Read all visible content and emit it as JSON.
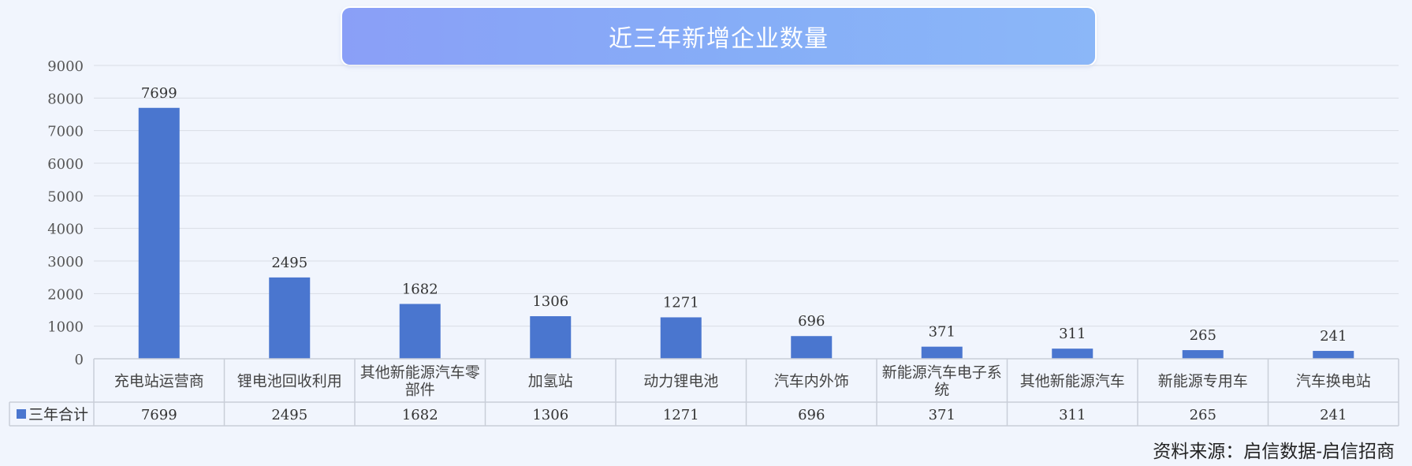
{
  "title": "近三年新增企业数量",
  "source": "资料来源：启信数据-启信招商",
  "colors": {
    "bar": "#4a76cf",
    "grid": "#d9dde5",
    "table_border": "#c9ced8",
    "title_gradient_start": "#8a9ff7",
    "title_gradient_end": "#8bb7f8"
  },
  "chart_data": {
    "type": "bar",
    "title": "近三年新增企业数量",
    "categories": [
      [
        "充电站运营商"
      ],
      [
        "锂电池回收利用"
      ],
      [
        "其他新能源汽车零",
        "部件"
      ],
      [
        "加氢站"
      ],
      [
        "动力锂电池"
      ],
      [
        "汽车内外饰"
      ],
      [
        "新能源汽车电子系",
        "统"
      ],
      [
        "其他新能源汽车"
      ],
      [
        "新能源专用车"
      ],
      [
        "汽车换电站"
      ]
    ],
    "series": [
      {
        "name": "三年合计",
        "values": [
          7699,
          2495,
          1682,
          1306,
          1271,
          696,
          371,
          311,
          265,
          241
        ]
      }
    ],
    "ylim": [
      0,
      9000
    ],
    "yticks": [
      0,
      1000,
      2000,
      3000,
      4000,
      5000,
      6000,
      7000,
      8000,
      9000
    ],
    "grid": true,
    "data_labels": true,
    "legend": "data-table"
  }
}
